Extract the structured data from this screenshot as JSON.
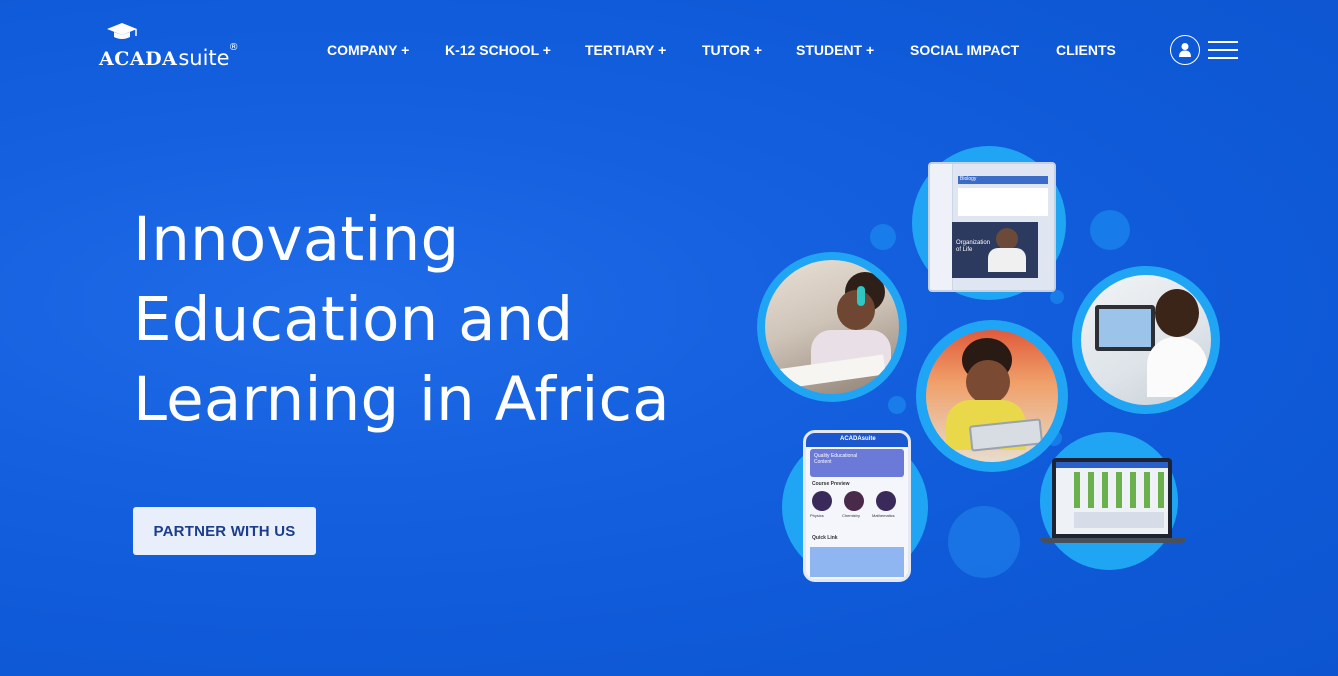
{
  "brand": {
    "logo_part1": "ACADA",
    "logo_part2": "suite",
    "registered": "®"
  },
  "nav": {
    "items": [
      {
        "label": "COMPANY +"
      },
      {
        "label": "K-12 SCHOOL +"
      },
      {
        "label": "TERTIARY +"
      },
      {
        "label": "TUTOR +"
      },
      {
        "label": "STUDENT +"
      },
      {
        "label": "SOCIAL IMPACT"
      },
      {
        "label": "CLIENTS"
      }
    ],
    "user_icon": "user-icon",
    "menu_icon": "hamburger-menu-icon"
  },
  "hero": {
    "title_lines": [
      "Innovating",
      "Education and",
      "Learning in Africa"
    ],
    "cta_label": "PARTNER WITH US"
  },
  "collage": {
    "laptop_screen": {
      "panel_title": "Biology",
      "video_caption": "Organization of Life"
    },
    "phone_screen": {
      "app_name": "ACADAsuite",
      "banner": "Quality Educational Content",
      "section_title": "Course Preview",
      "courses": [
        "Physics",
        "Chemistry",
        "Mathematics"
      ],
      "footer": "Quick Link"
    }
  },
  "colors": {
    "background": "#1460de",
    "ring": "#20a5f5",
    "cta_bg": "#e9eefb",
    "cta_text": "#1c3d8c"
  }
}
